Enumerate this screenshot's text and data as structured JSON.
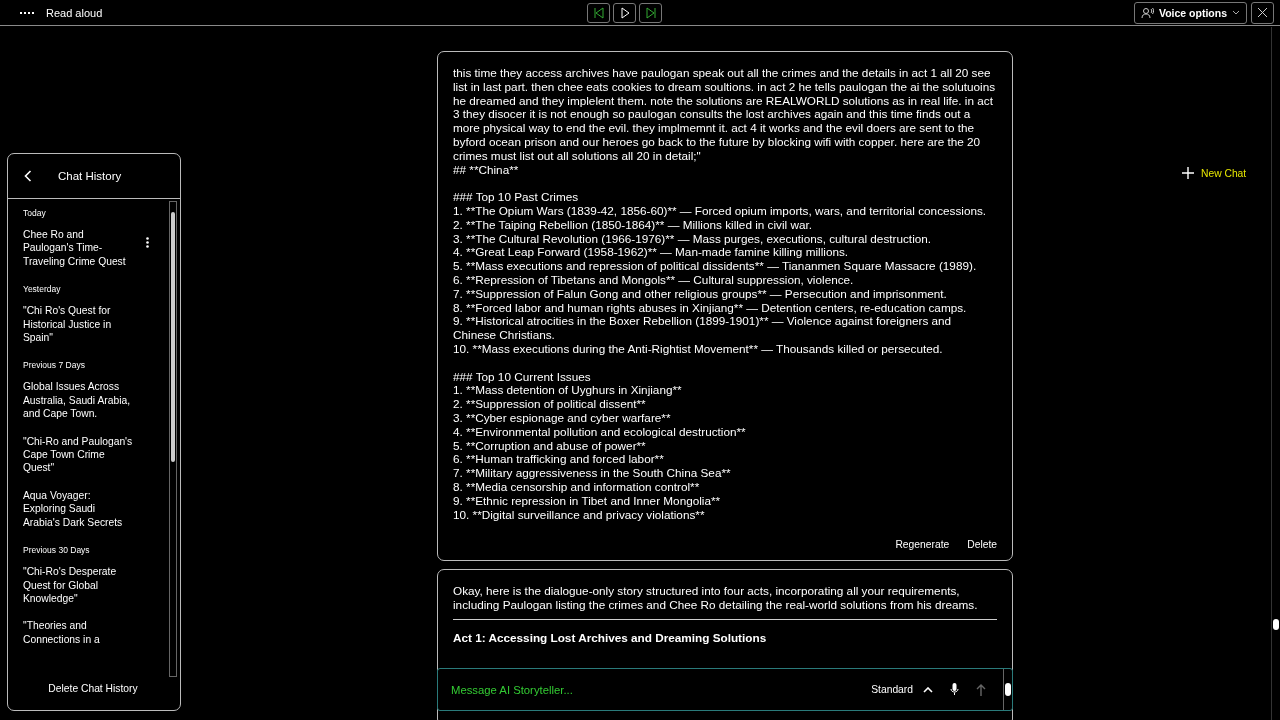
{
  "read_aloud_bar": {
    "title": "Read aloud",
    "voice_button": "Voice options"
  },
  "sidebar": {
    "title": "Chat History",
    "groups": [
      {
        "label": "Today",
        "items": [
          {
            "title": "Chee Ro and Paulogan's Time-Traveling Crime Quest",
            "selected": true
          }
        ]
      },
      {
        "label": "Yesterday",
        "items": [
          {
            "title": "\"Chi Ro's Quest for Historical Justice in Spain\"",
            "selected": false
          }
        ]
      },
      {
        "label": "Previous 7 Days",
        "items": [
          {
            "title": "Global Issues Across Australia, Saudi Arabia, and Cape Town.",
            "selected": false
          },
          {
            "title": "\"Chi-Ro and Paulogan's Cape Town Crime Quest\"",
            "selected": false
          },
          {
            "title": "Aqua Voyager: Exploring Saudi Arabia's Dark Secrets",
            "selected": false
          }
        ]
      },
      {
        "label": "Previous 30 Days",
        "items": [
          {
            "title": "\"Chi-Ro's Desperate Quest for Global Knowledge\"",
            "selected": false
          },
          {
            "title": "\"Theories and Connections in a",
            "selected": false
          }
        ]
      }
    ],
    "footer_button": "Delete Chat History"
  },
  "new_chat": "New Chat",
  "messages": [
    {
      "intro": "this time they access archives have paulogan speak out all the crimes and the details in act 1 all 20 see list in last part. then chee eats cookies to dream soultions. in act 2 he tells paulogan the ai the solutuoins he dreamed and they implelent them. note the solutions are REALWORLD solutions as in real life. in act 3 they disocer it is not enough so paulogan consults the lost archives again and this time finds out a more physical way to end the evil. they implmemnt it. act 4 it works and the evil doers are sent to the byford ocean prison and our heroes go back to the future by blocking wifi with copper. here are the 20 crimes must  list out all solutions all 20 in detail;\"",
      "heading": "## **China**",
      "sections": [
        {
          "title": "### Top 10 Past Crimes",
          "items": [
            "1. **The Opium Wars (1839-42, 1856-60)** — Forced opium imports, wars, and territorial concessions.",
            "2. **The Taiping Rebellion (1850-1864)** — Millions killed in civil war.",
            "3. **The Cultural Revolution (1966-1976)** — Mass purges, executions, cultural destruction.",
            "4. **Great Leap Forward (1958-1962)** — Man-made famine killing millions.",
            "5. **Mass executions and repression of political dissidents** — Tiananmen Square Massacre (1989).",
            "6. **Repression of Tibetans and Mongols** — Cultural suppression, violence.",
            "7. **Suppression of Falun Gong and other religious groups** — Persecution and imprisonment.",
            "8. **Forced labor and human rights abuses in Xinjiang** — Detention centers, re-education camps.",
            "9. **Historical atrocities in the Boxer Rebellion (1899-1901)** — Violence against foreigners and Chinese Christians.",
            "10. **Mass executions during the Anti-Rightist Movement** — Thousands killed or persecuted."
          ]
        },
        {
          "title": "### Top 10 Current Issues",
          "items": [
            "1. **Mass detention of Uyghurs in Xinjiang**",
            "2. **Suppression of political dissent**",
            "3. **Cyber espionage and cyber warfare**",
            "4. **Environmental pollution and ecological destruction**",
            "5. **Corruption and abuse of power**",
            "6. **Human trafficking and forced labor**",
            "7. **Military aggressiveness in the South China Sea**",
            "8. **Media censorship and information control**",
            "9. **Ethnic repression in Tibet and Inner Mongolia**",
            "10. **Digital surveillance and privacy violations**"
          ]
        }
      ],
      "actions": [
        "Regenerate",
        "Delete"
      ]
    },
    {
      "intro": "Okay, here is the dialogue-only story structured into four acts, incorporating all your requirements, including Paulogan listing the crimes and Chee Ro detailing the real-world solutions from his dreams.",
      "heading": "Act 1: Accessing Lost Archives and Dreaming Solutions"
    }
  ],
  "composer": {
    "placeholder": "Message AI Storyteller...",
    "mode": "Standard"
  }
}
